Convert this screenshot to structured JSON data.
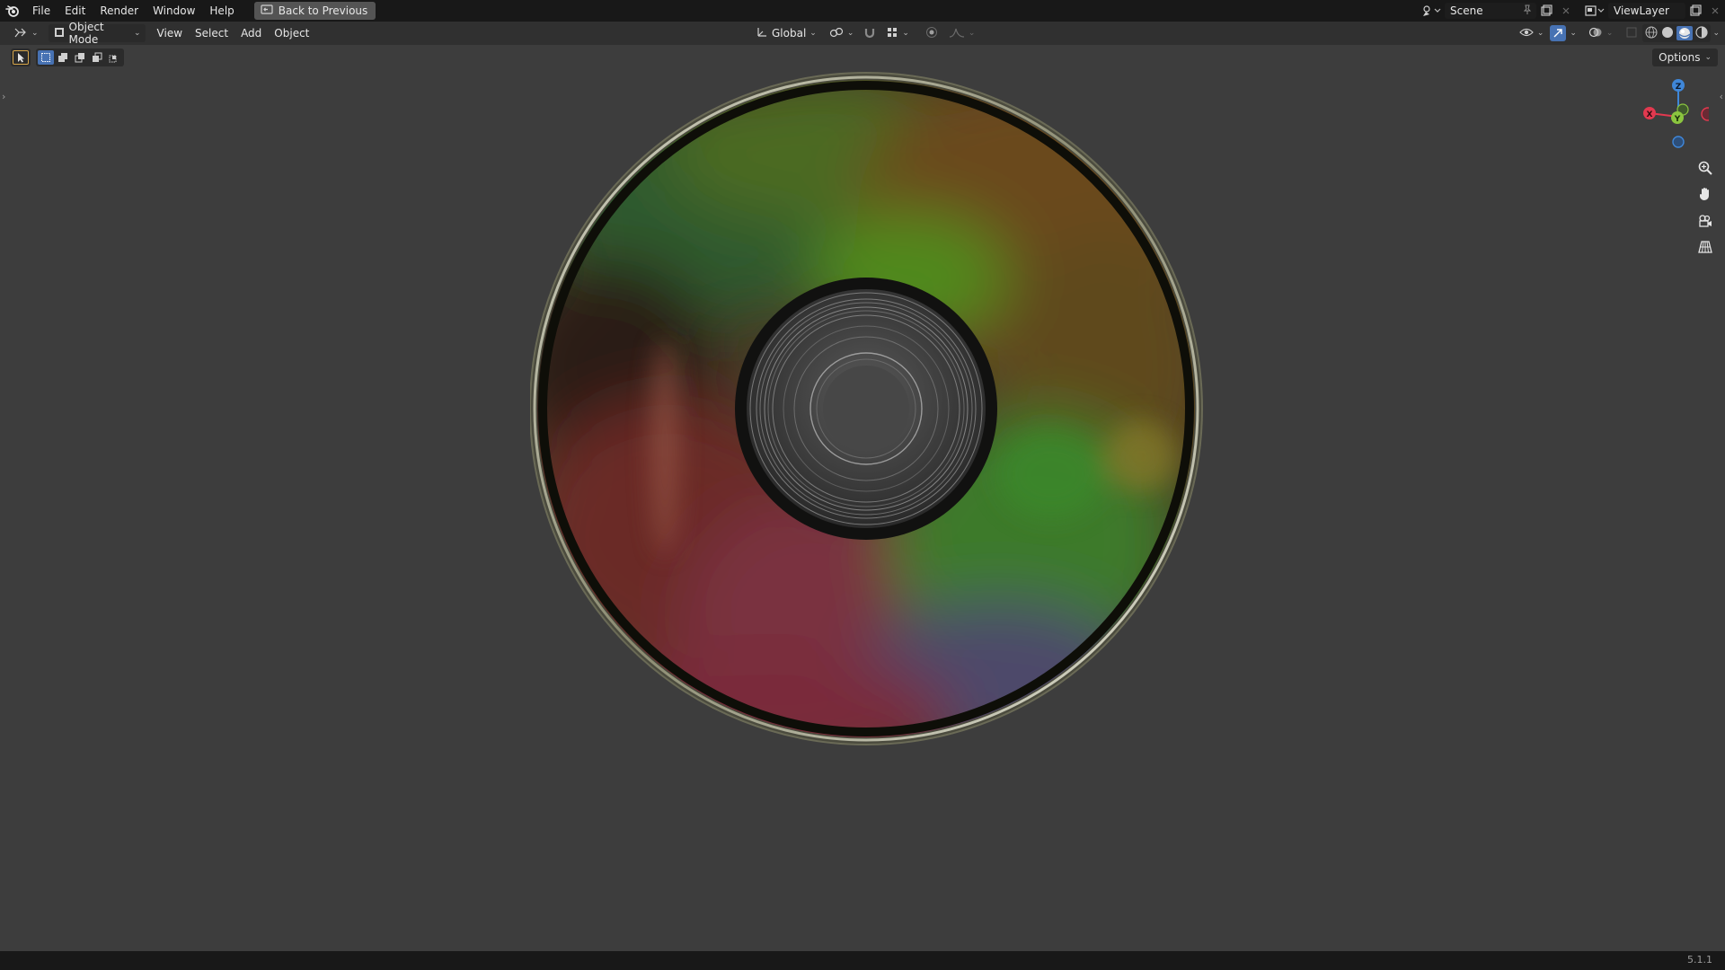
{
  "topbar": {
    "menus": [
      "File",
      "Edit",
      "Render",
      "Window",
      "Help"
    ],
    "back_button": "Back to Previous",
    "scene_label": "Scene",
    "view_layer_label": "ViewLayer"
  },
  "header": {
    "mode": "Object Mode",
    "menus": [
      "View",
      "Select",
      "Add",
      "Object"
    ],
    "transform_orientation": "Global",
    "options_label": "Options"
  },
  "gizmo": {
    "x_label": "X",
    "y_label": "Y",
    "z_label": "Z",
    "x_color": "#e2394f",
    "y_color": "#8bc53f",
    "z_color": "#3f87d9"
  },
  "status": {
    "version": "5.1.1"
  },
  "colors": {
    "accent": "#4772b3",
    "background": "#3d3d3d",
    "topbar": "#181818",
    "header": "#303030"
  }
}
